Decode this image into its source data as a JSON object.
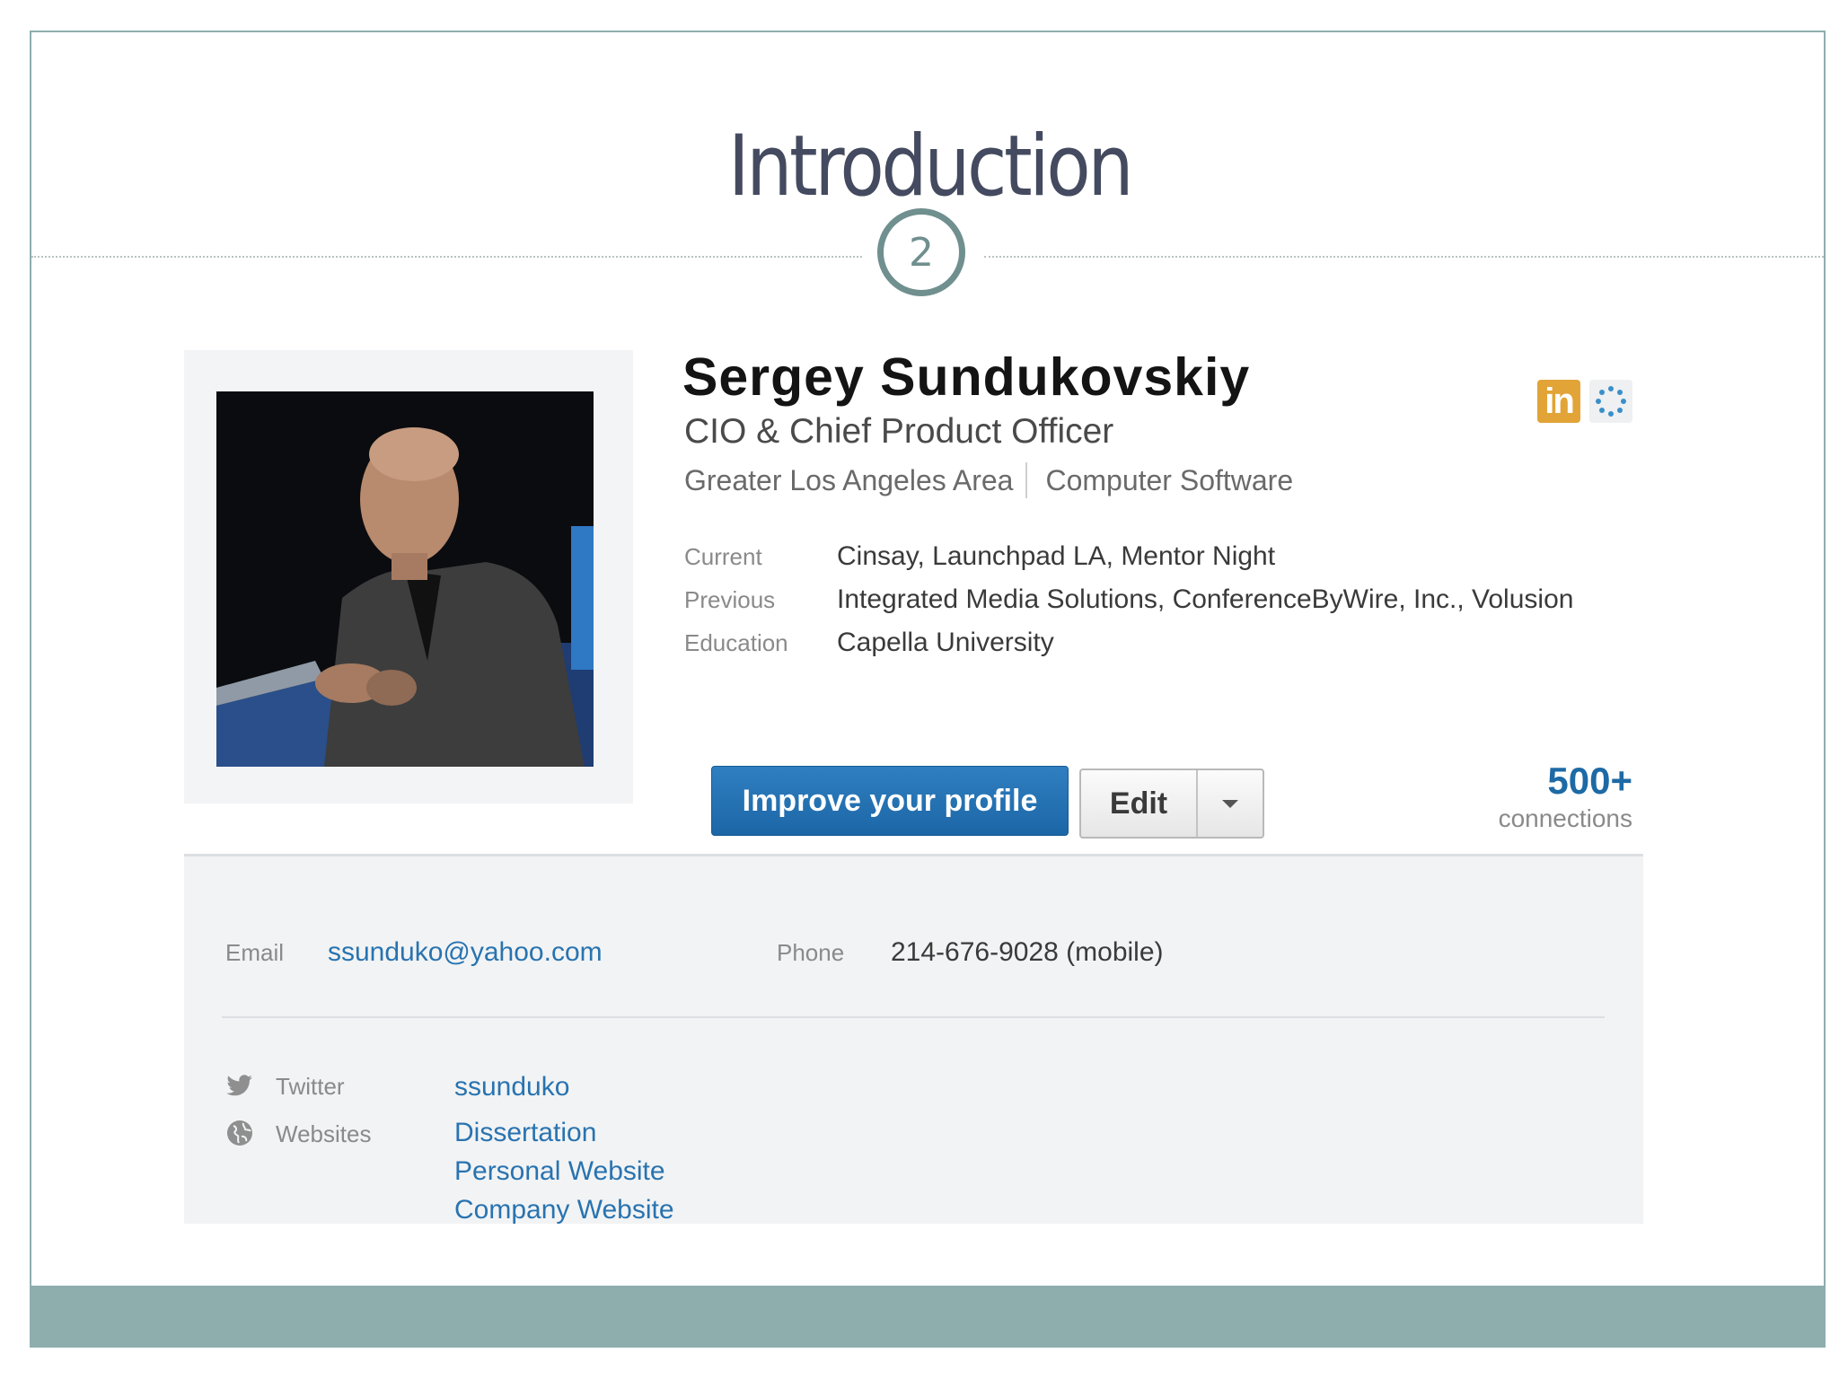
{
  "slide": {
    "title": "Introduction",
    "number": "2"
  },
  "profile": {
    "name": "Sergey Sundukovskiy",
    "headline": "CIO & Chief Product Officer",
    "location": "Greater Los Angeles Area",
    "industry": "Computer Software",
    "facts": [
      {
        "label": "Current",
        "value": "Cinsay, Launchpad LA, Mentor Night"
      },
      {
        "label": "Previous",
        "value": "Integrated Media Solutions, ConferenceByWire, Inc., Volusion"
      },
      {
        "label": "Education",
        "value": "Capella University"
      }
    ],
    "badge_text": "in",
    "improve_label": "Improve your profile",
    "edit_label": "Edit",
    "connections_count": "500+",
    "connections_label": "connections"
  },
  "contact": {
    "email_label": "Email",
    "email_value": "ssunduko@yahoo.com",
    "phone_label": "Phone",
    "phone_value": "214-676-9028 (mobile)",
    "twitter_label": "Twitter",
    "twitter_value": "ssunduko",
    "websites_label": "Websites",
    "websites": [
      "Dissertation",
      "Personal Website",
      "Company Website"
    ]
  },
  "colors": {
    "accent": "#8eadad",
    "title": "#444a5f",
    "link": "#2873b0",
    "primary_button": "#1c66a6",
    "linkedin_badge": "#e2a437"
  },
  "icons": [
    "linkedin-icon",
    "connections-ring-icon",
    "caret-down-icon",
    "twitter-icon",
    "globe-icon"
  ]
}
